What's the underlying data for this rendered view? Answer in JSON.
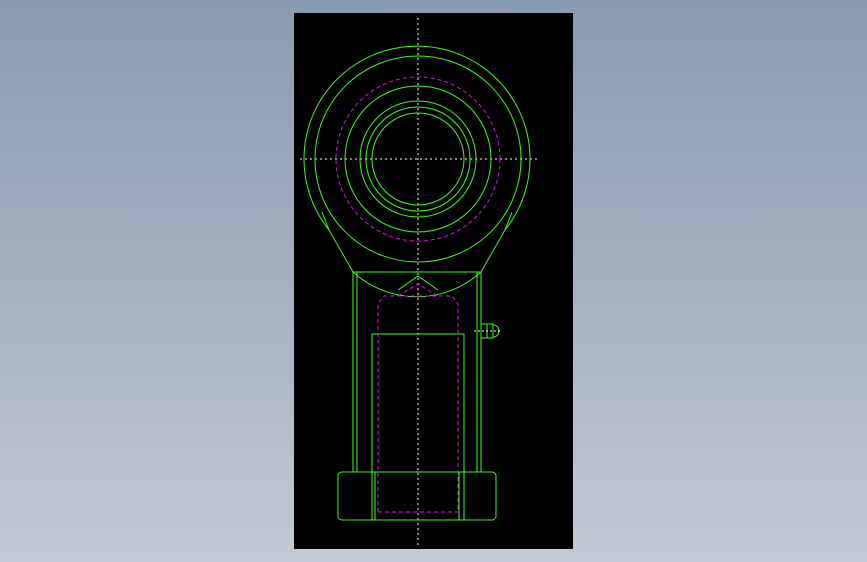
{
  "canvas": {
    "background": "#000000",
    "page_background": "gradient-grey-blue"
  },
  "colors": {
    "outline": "#39ff14",
    "hidden_line": "#e010e0",
    "centerline": "#ffffff"
  },
  "drawing": {
    "part": "rod end",
    "view": "front"
  }
}
